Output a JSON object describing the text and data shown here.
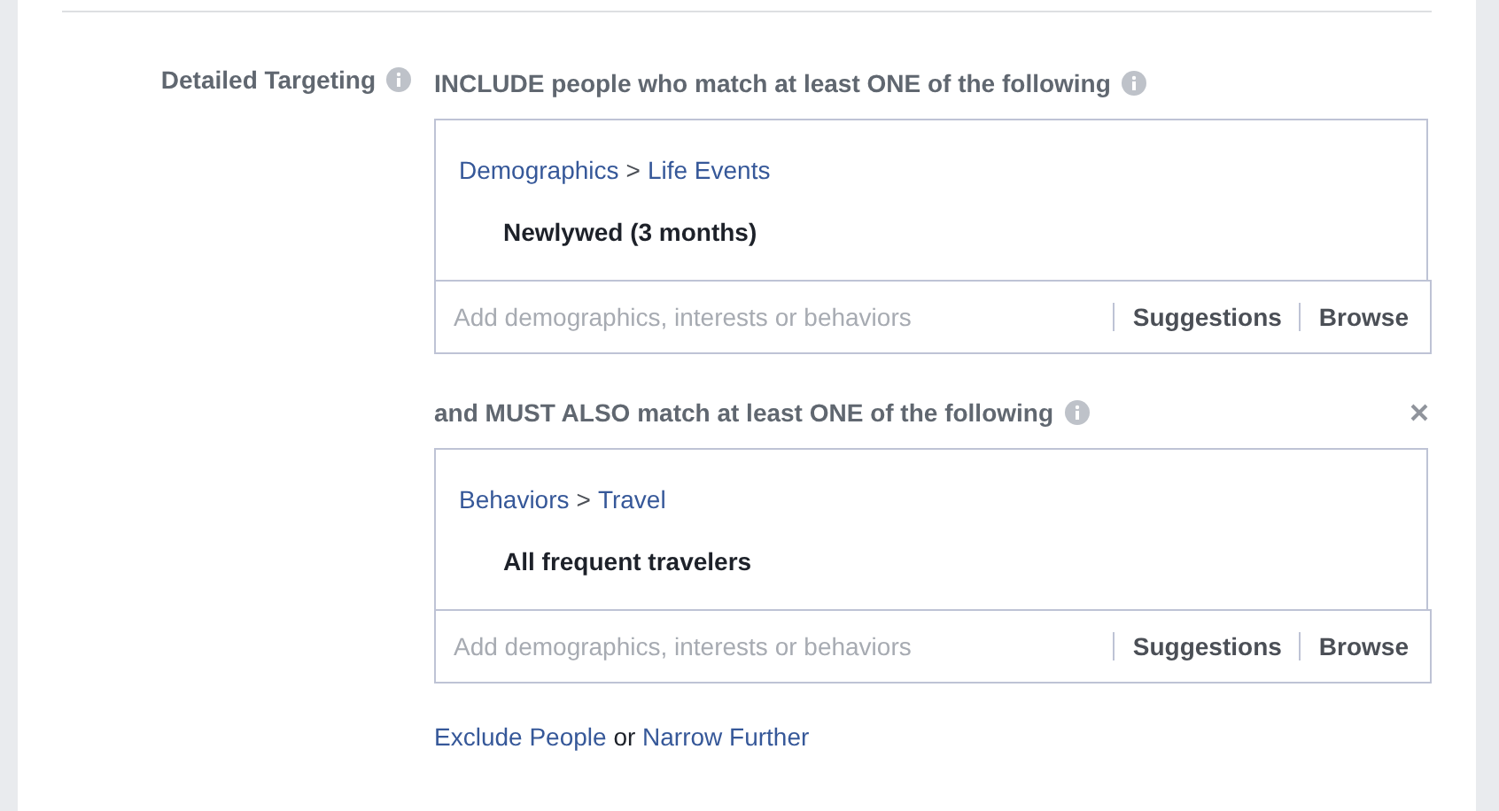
{
  "label": "Detailed Targeting",
  "groups": [
    {
      "heading": "INCLUDE people who match at least ONE of the following",
      "removable": false,
      "path": [
        {
          "kind": "link",
          "text": "Demographics"
        },
        {
          "kind": "separator",
          "text": ">"
        },
        {
          "kind": "link",
          "text": "Life Events"
        }
      ],
      "items": [
        "Newlywed (3 months)"
      ],
      "search": {
        "placeholder": "Add demographics, interests or behaviors"
      },
      "actions": [
        "Suggestions",
        "Browse"
      ]
    },
    {
      "heading": "and MUST ALSO match at least ONE of the following",
      "removable": true,
      "path": [
        {
          "kind": "link",
          "text": "Behaviors"
        },
        {
          "kind": "separator",
          "text": ">"
        },
        {
          "kind": "link",
          "text": "Travel"
        }
      ],
      "items": [
        "All frequent travelers"
      ],
      "search": {
        "placeholder": "Add demographics, interests or behaviors"
      },
      "actions": [
        "Suggestions",
        "Browse"
      ]
    }
  ],
  "footer": [
    {
      "kind": "link",
      "text": "Exclude People"
    },
    {
      "kind": "text",
      "text": "or"
    },
    {
      "kind": "link",
      "text": "Narrow Further"
    }
  ]
}
